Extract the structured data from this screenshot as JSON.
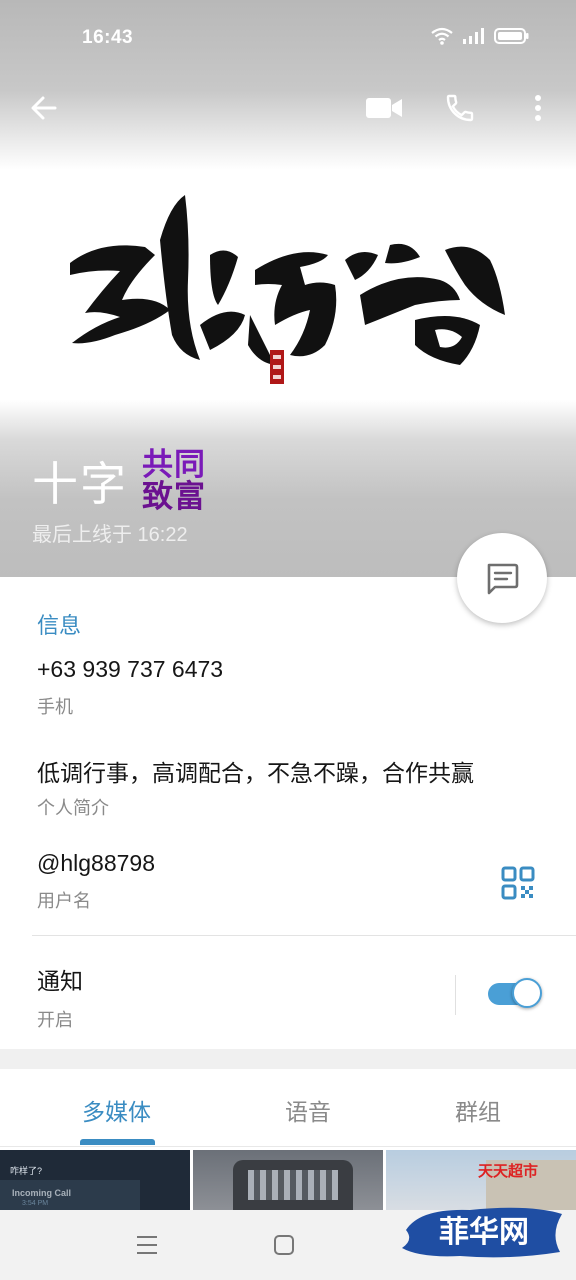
{
  "status_bar": {
    "time": "16:43"
  },
  "profile": {
    "name": "十字",
    "badge_line1": "共同",
    "badge_line2": "致富",
    "last_seen": "最后上线于 16:22"
  },
  "info": {
    "section_title": "信息",
    "phone": {
      "value": "+63 939 737 6473",
      "label": "手机"
    },
    "bio": {
      "value": "低调行事，高调配合，不急不躁，合作共赢",
      "label": "个人简介"
    },
    "username": {
      "value": "@hlg88798",
      "label": "用户名"
    },
    "notifications": {
      "value": "通知",
      "label": "开启",
      "enabled": true
    }
  },
  "tabs": [
    {
      "label": "多媒体",
      "active": true
    },
    {
      "label": "语音",
      "active": false
    },
    {
      "label": "群组",
      "active": false
    }
  ],
  "media_thumbs": [
    {
      "text_1": "咋样了?",
      "text_2": "Incoming Call",
      "text_3": "3:54 PM"
    },
    {
      "text_1": ""
    },
    {
      "text_1": "天天超市"
    }
  ],
  "watermark": {
    "text": "菲华网"
  },
  "colors": {
    "accent": "#3a8cc2",
    "toggle": "#4a9fd6",
    "badge": "#7a1ab8"
  },
  "icons": [
    "back-arrow-icon",
    "video-call-icon",
    "phone-icon",
    "more-vert-icon",
    "message-icon",
    "qr-code-icon",
    "nav-menu-icon",
    "nav-home-icon",
    "wifi-icon",
    "signal-icon",
    "battery-icon"
  ]
}
